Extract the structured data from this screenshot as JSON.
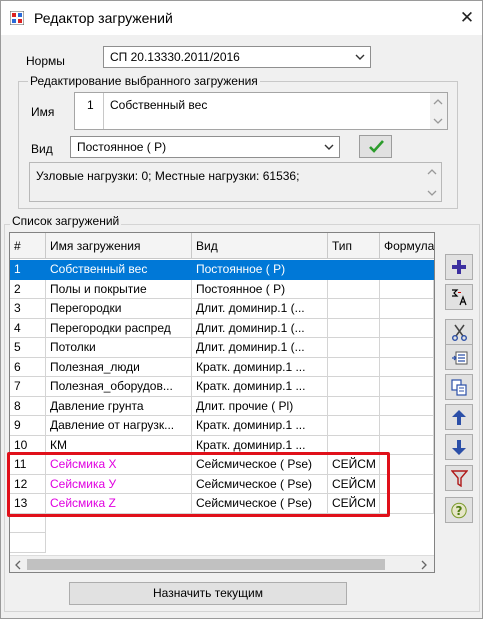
{
  "window": {
    "title": "Редактор загружений",
    "close_glyph": "✕"
  },
  "norms": {
    "label": "Нормы",
    "value": "СП 20.13330.2011/2016"
  },
  "edit_group": {
    "title": "Редактирование выбранного загружения",
    "name_label": "Имя",
    "name_number": "1",
    "name_value": "Собственный вес",
    "kind_label": "Вид",
    "kind_value": "Постоянное ( P)",
    "info": "Узловые нагрузки:  0;  Местные нагрузки:  61536;"
  },
  "list_group": {
    "title": "Список загружений",
    "columns": [
      "#",
      "Имя загружения",
      "Вид",
      "Тип",
      "Формула"
    ],
    "rows": [
      {
        "num": "1",
        "name": "Собственный вес",
        "kind": "Постоянное ( P)",
        "type": "",
        "formula": ""
      },
      {
        "num": "2",
        "name": "Полы и покрытие",
        "kind": "Постоянное ( P)",
        "type": "",
        "formula": ""
      },
      {
        "num": "3",
        "name": "Перегородки",
        "kind": "Длит. доминир.1 (...",
        "type": "",
        "formula": ""
      },
      {
        "num": "4",
        "name": "Перегородки распред",
        "kind": "Длит. доминир.1 (...",
        "type": "",
        "formula": ""
      },
      {
        "num": "5",
        "name": "Потолки",
        "kind": "Длит. доминир.1 (...",
        "type": "",
        "formula": ""
      },
      {
        "num": "6",
        "name": "Полезная_люди",
        "kind": "Кратк. доминир.1 ...",
        "type": "",
        "formula": ""
      },
      {
        "num": "7",
        "name": "Полезная_оборудов...",
        "kind": "Кратк. доминир.1 ...",
        "type": "",
        "formula": ""
      },
      {
        "num": "8",
        "name": "Давление грунта",
        "kind": "Длит. прочие ( Pl)",
        "type": "",
        "formula": ""
      },
      {
        "num": "9",
        "name": "Давление от нагрузк...",
        "kind": "Кратк. доминир.1 ...",
        "type": "",
        "formula": ""
      },
      {
        "num": "10",
        "name": "КМ",
        "kind": "Кратк. доминир.1 ...",
        "type": "",
        "formula": ""
      },
      {
        "num": "11",
        "name": "Сейсмика X",
        "kind": "Сейсмическое ( Pse)",
        "type": "СЕЙСМ",
        "formula": ""
      },
      {
        "num": "12",
        "name": "Сейсмика У",
        "kind": "Сейсмическое ( Pse)",
        "type": "СЕЙСМ",
        "formula": ""
      },
      {
        "num": "13",
        "name": "Сейсмика Z",
        "kind": "Сейсмическое ( Pse)",
        "type": "СЕЙСМ",
        "formula": ""
      }
    ],
    "selected_row": 1,
    "seismic_color": "#e000e0",
    "highlight_color": "#e0101a"
  },
  "toolbar": {
    "icons": [
      "add-icon",
      "sum-sort-icon",
      "cut-icon",
      "insert-icon",
      "copy-icon",
      "move-up-icon",
      "move-down-icon",
      "filter-icon",
      "help-icon"
    ]
  },
  "bottom": {
    "assign_label": "Назначить текущим"
  },
  "colors": {
    "selection": "#0078d7",
    "accent_blue": "#2b4fa8",
    "ok_green": "#2c9c2c"
  }
}
